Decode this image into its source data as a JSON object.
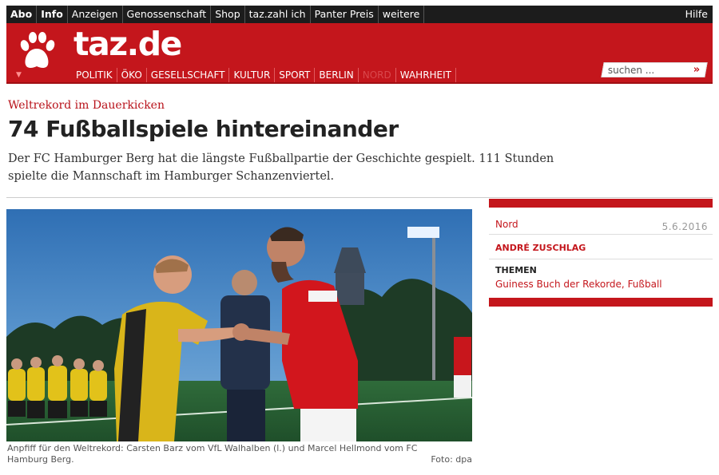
{
  "topbar": {
    "links": [
      "Abo",
      "Info",
      "Anzeigen",
      "Genossenschaft",
      "Shop",
      "taz.zahl ich",
      "Panter Preis",
      "weitere"
    ],
    "help": "Hilfe"
  },
  "header": {
    "logo": "taz.de",
    "nav": [
      "POLITIK",
      "ÖKO",
      "GESELLSCHAFT",
      "KULTUR",
      "SPORT",
      "BERLIN",
      "NORD",
      "WAHRHEIT"
    ],
    "search_placeholder": "suchen ...",
    "search_button": "»"
  },
  "article": {
    "kicker": "Weltrekord im Dauerkicken",
    "headline": "74 Fußballspiele hintereinander",
    "lead": "Der FC Hamburger Berg hat die längste Fußballpartie der Geschichte gespielt. 111 Stunden spielte die Mannschaft im Hamburger Schanzenviertel.",
    "caption": "Anpfiff für den Weltrekord: Carsten Barz vom VfL Walhalben (l.) und Marcel Hellmond vom FC Hamburg Berg.",
    "credit": "Foto: dpa"
  },
  "sidebar": {
    "ressort": "Nord",
    "date": "5.6.2016",
    "author": "ANDRÉ ZUSCHLAG",
    "topics_label": "THEMEN",
    "topics": [
      "Guiness Buch der Rekorde",
      "Fußball"
    ],
    "topic_sep": ", "
  },
  "colors": {
    "brand_red": "#c4161c",
    "topbar": "#1c1c1c"
  },
  "icons": {
    "logo": "paw-icon",
    "search": "double-chevron-icon"
  }
}
